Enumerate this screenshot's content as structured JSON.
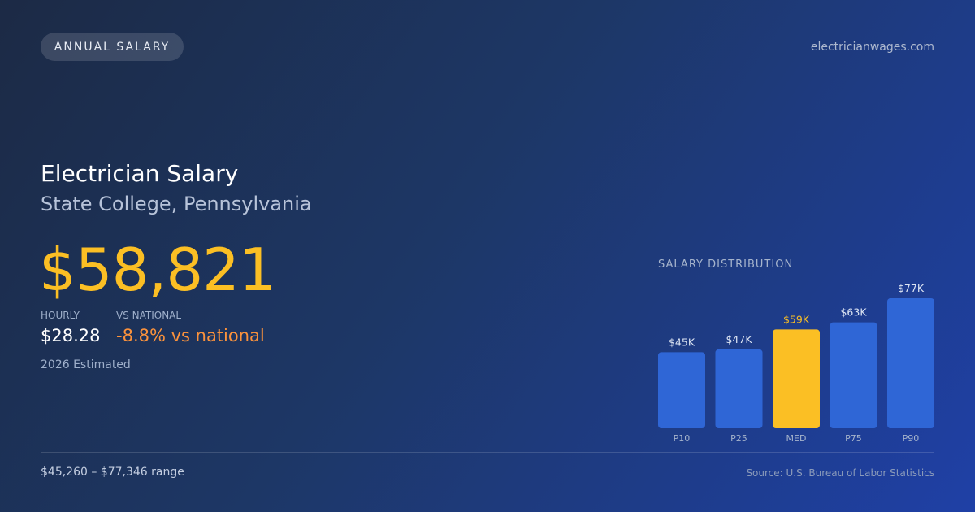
{
  "header": {
    "badge": "ANNUAL SALARY",
    "site": "electricianwages.com"
  },
  "main": {
    "title": "Electrician Salary",
    "location": "State College, Pennsylvania",
    "salary": "$58,821",
    "hourly_label": "HOURLY",
    "hourly_value": "$28.28",
    "national_label": "VS NATIONAL",
    "national_value": "-8.8% vs national",
    "estimate_note": "2026 Estimated"
  },
  "footer": {
    "range": "$45,260 – $77,346 range",
    "source": "Source: U.S. Bureau of Labor Statistics"
  },
  "colors": {
    "accent": "#fbbf24",
    "negative": "#fb923c",
    "bar": "#2f66d6"
  },
  "chart_data": {
    "type": "bar",
    "title": "SALARY DISTRIBUTION",
    "categories": [
      "P10",
      "P25",
      "MED",
      "P75",
      "P90"
    ],
    "values": [
      45260,
      47000,
      58821,
      63000,
      77346
    ],
    "data_labels": [
      "$45K",
      "$47K",
      "$59K",
      "$63K",
      "$77K"
    ],
    "highlight_index": 2,
    "ylim": [
      0,
      77346
    ],
    "grid": false
  }
}
